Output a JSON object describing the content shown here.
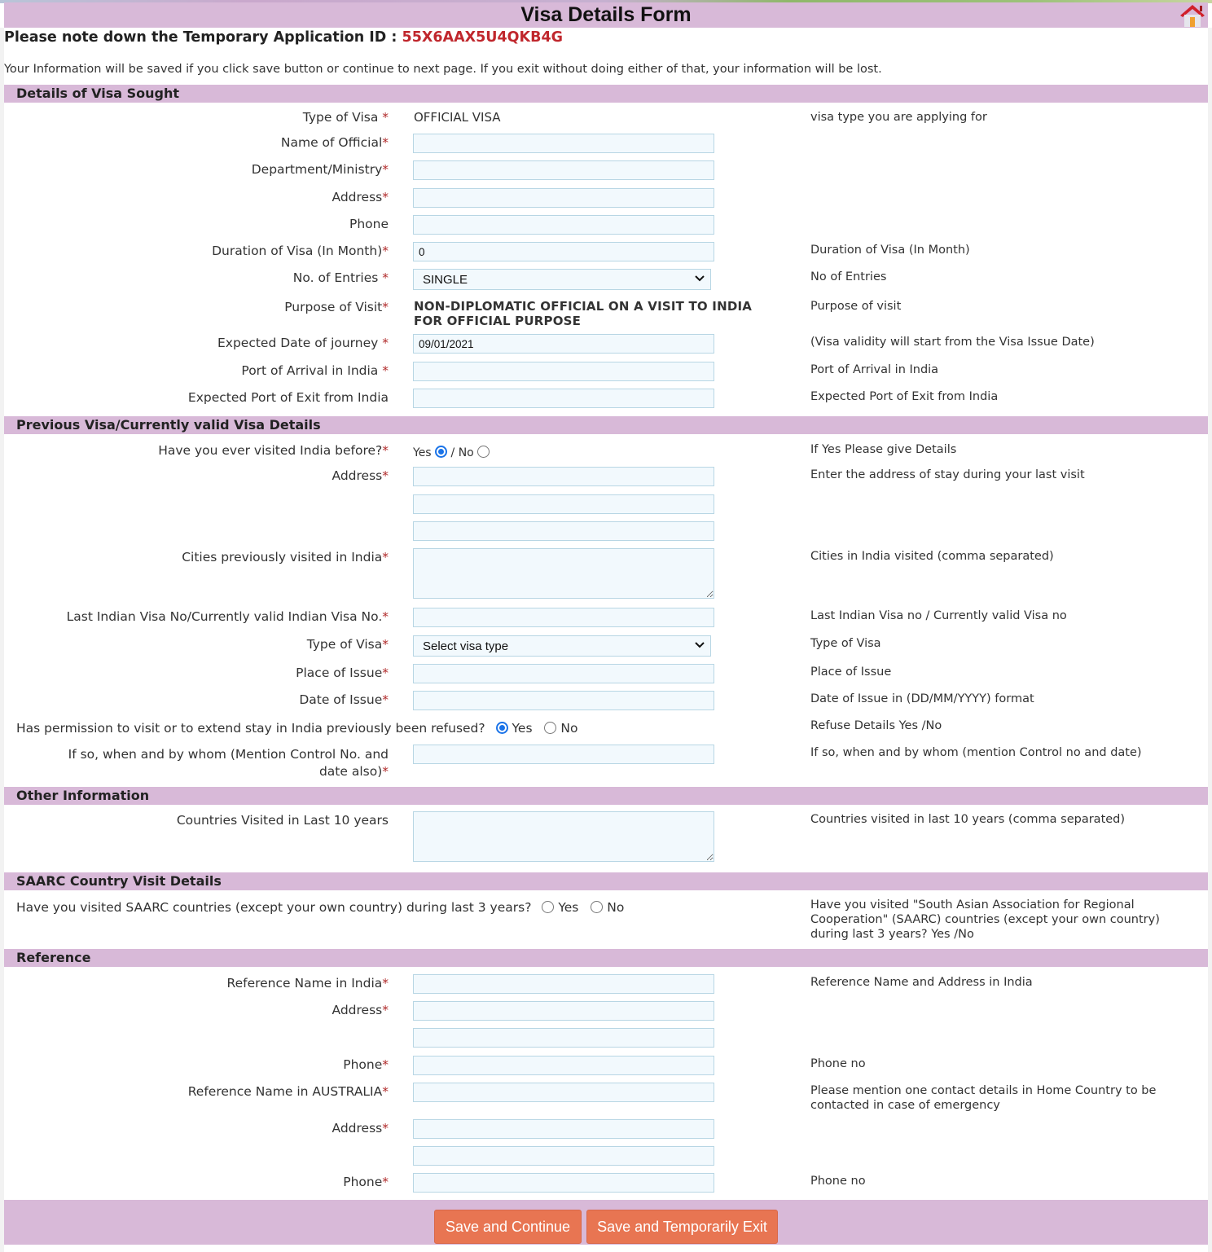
{
  "page": {
    "title": "Visa Details Form",
    "app_id_label": "Please note down the Temporary Application ID :",
    "app_id_value": "55X6AAX5U4QKB4G",
    "info": "Your Information will be saved if you click save button or continue to next page. If you exit without doing either of that, your information will be lost.",
    "required_mark": "*",
    "colors": {
      "header_bg": "#d8b9d8",
      "id_red": "#c0272d",
      "button_bg": "#e87552",
      "input_bg": "#f2f9fd",
      "input_border": "#b8d6e4"
    }
  },
  "sections": {
    "visa_sought": {
      "title": "Details of Visa Sought",
      "type_of_visa": {
        "label": "Type of Visa ",
        "value": "OFFICIAL VISA",
        "hint": "visa type you are applying for"
      },
      "name_of_official": {
        "label": "Name of Official",
        "value": ""
      },
      "department": {
        "label": "Department/Ministry",
        "value": ""
      },
      "address": {
        "label": "Address",
        "value": ""
      },
      "phone": {
        "label": "Phone",
        "value": ""
      },
      "duration": {
        "label": "Duration of Visa (In Month)",
        "value": "0",
        "hint": "Duration of Visa (In Month)"
      },
      "entries": {
        "label": "No. of Entries ",
        "value": "SINGLE",
        "hint": "No of Entries"
      },
      "purpose": {
        "label": "Purpose of Visit",
        "value": "NON-DIPLOMATIC OFFICIAL ON A VISIT TO INDIA FOR OFFICIAL PURPOSE",
        "hint": "Purpose of visit"
      },
      "journey_date": {
        "label": "Expected Date of journey ",
        "value": "09/01/2021",
        "hint": "(Visa validity will start from the Visa Issue Date)"
      },
      "port_arrival": {
        "label": "Port of Arrival in India ",
        "value": "",
        "hint": "Port of Arrival in India"
      },
      "port_exit": {
        "label": "Expected Port of Exit from India",
        "value": "",
        "hint": "Expected Port of Exit from India"
      }
    },
    "previous_visa": {
      "title": "Previous Visa/Currently valid Visa Details",
      "visited_before": {
        "label": "Have you ever visited India before?",
        "yes": "Yes",
        "sep": " / ",
        "no": "No",
        "selected": "Yes",
        "hint": "If Yes Please give Details"
      },
      "address": {
        "label": "Address",
        "line1": "",
        "line2": "",
        "line3": "",
        "hint": "Enter the address of stay during your last visit"
      },
      "cities": {
        "label": "Cities previously visited in India",
        "value": "",
        "hint": "Cities in India visited (comma separated)"
      },
      "last_visa_no": {
        "label": "Last Indian Visa No/Currently valid Indian Visa No.",
        "value": "",
        "hint": "Last Indian Visa no / Currently valid Visa no"
      },
      "type_of_visa": {
        "label": "Type of Visa",
        "value": "Select visa type",
        "hint": "Type of Visa"
      },
      "place_of_issue": {
        "label": "Place of Issue",
        "value": "",
        "hint": "Place of Issue"
      },
      "date_of_issue": {
        "label": "Date of Issue",
        "value": "",
        "hint": "Date of Issue in (DD/MM/YYYY) format"
      },
      "refused": {
        "label": "Has permission to visit or to extend stay in India previously been refused?",
        "yes": "Yes",
        "no": "No",
        "selected": "Yes",
        "hint": "Refuse Details Yes /No"
      },
      "refused_details": {
        "label_line1": "If so, when and by whom (Mention Control No. and",
        "label_line2": "date also)",
        "value": "",
        "hint": "If so, when and by whom (mention Control no and date)"
      }
    },
    "other_info": {
      "title": "Other Information",
      "countries": {
        "label": "Countries Visited in Last 10 years",
        "value": "",
        "hint": "Countries visited in last 10 years (comma separated)"
      }
    },
    "saarc": {
      "title": "SAARC Country Visit Details",
      "question": {
        "label": "Have you visited SAARC countries (except your own country) during last 3 years?",
        "yes": "Yes",
        "no": "No",
        "selected": null,
        "hint": "Have you visited \"South Asian Association for Regional Cooperation\" (SAARC) countries (except your own country) during last 3 years? Yes /No"
      }
    },
    "reference": {
      "title": "Reference",
      "india_name": {
        "label": "Reference Name in India",
        "value": "",
        "hint": "Reference Name and Address in India"
      },
      "india_address": {
        "label": "Address",
        "line1": "",
        "line2": ""
      },
      "india_phone": {
        "label": "Phone",
        "value": "",
        "hint": "Phone no"
      },
      "home_name": {
        "label": "Reference Name in AUSTRALIA",
        "value": "",
        "hint": "Please mention one contact details in Home Country to be contacted in case of emergency"
      },
      "home_address": {
        "label": "Address",
        "line1": "",
        "line2": ""
      },
      "home_phone": {
        "label": "Phone",
        "value": "",
        "hint": "Phone no"
      }
    }
  },
  "buttons": {
    "save_continue": "Save and Continue",
    "save_exit": "Save and Temporarily Exit"
  },
  "icons": {
    "home": "home-icon",
    "dropdown": "chevron-down-icon",
    "resize": "resize-grip-icon"
  }
}
